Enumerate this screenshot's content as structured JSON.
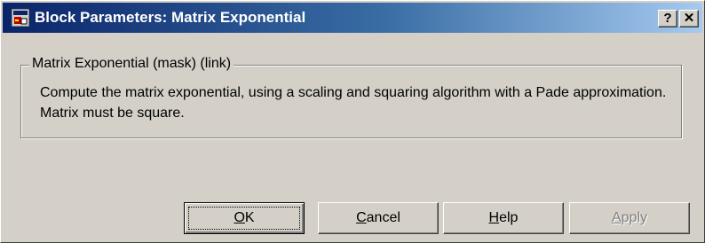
{
  "window": {
    "title": "Block Parameters: Matrix Exponential",
    "help_button": "?",
    "close_button": "✕"
  },
  "group": {
    "label": "Matrix Exponential (mask) (link)",
    "description": "Compute the matrix exponential, using a scaling and squaring algorithm with a Pade approximation.  Matrix must be square."
  },
  "buttons": {
    "ok": {
      "mnemonic": "O",
      "rest": "K"
    },
    "cancel": {
      "mnemonic": "C",
      "rest": "ancel"
    },
    "help": {
      "mnemonic": "H",
      "rest": "elp"
    },
    "apply": {
      "mnemonic": "A",
      "rest": "pply"
    }
  },
  "colors": {
    "titlebar_start": "#0a246a",
    "titlebar_end": "#a6caf0",
    "face": "#d4d0c8"
  }
}
